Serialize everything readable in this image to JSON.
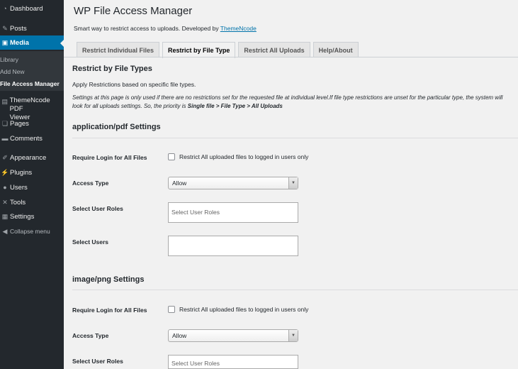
{
  "sidebar": {
    "items": [
      {
        "label": "Dashboard",
        "icon": "dashboard-icon"
      },
      {
        "label": "Posts",
        "icon": "pin-icon"
      },
      {
        "label": "Media",
        "icon": "media-icon"
      },
      {
        "label": "ThemeNcode PDF Viewer",
        "icon": "page-icon"
      },
      {
        "label": "Pages",
        "icon": "pages-icon"
      },
      {
        "label": "Comments",
        "icon": "comments-icon"
      },
      {
        "label": "Appearance",
        "icon": "brush-icon"
      },
      {
        "label": "Plugins",
        "icon": "plugin-icon"
      },
      {
        "label": "Users",
        "icon": "user-icon"
      },
      {
        "label": "Tools",
        "icon": "wrench-icon"
      },
      {
        "label": "Settings",
        "icon": "settings-icon"
      },
      {
        "label": "Collapse menu",
        "icon": "collapse-icon"
      }
    ],
    "media_submenu": [
      "Library",
      "Add New",
      "File Access Manager"
    ],
    "pdf_viewer": {
      "line1": "ThemeNcode PDF",
      "line2": "Viewer"
    },
    "accent": "#0073aa"
  },
  "header": {
    "title": "WP File Access Manager",
    "tagline_prefix": "Smart way to restrict access to uploads. Developed by",
    "tagline_link": "ThemeNcode"
  },
  "tabs": [
    {
      "label": "Restrict Individual Files"
    },
    {
      "label": "Restrict by File Type",
      "active": true
    },
    {
      "label": "Restrict All Uploads"
    },
    {
      "label": "Help/About"
    }
  ],
  "content": {
    "heading": "Restrict by File Types",
    "description": "Apply Restrictions based on specific file types.",
    "note_line1": "Settings at this page is only used if there are no restrictions set for the requested file at individual level.If file type restrictions are unset for the particular type, the system will",
    "note_line2_prefix": "look for all uploads settings. So, the priority is",
    "note_line2_bold": "Single file > File Type > All Uploads"
  },
  "sections": [
    {
      "title": "application/pdf Settings",
      "require_login_label": "Require Login for All Files",
      "checkbox_label": "Restrict All uploaded files to logged in users only",
      "access_type_label": "Access Type",
      "access_type_value": "Allow",
      "roles_label": "Select User Roles",
      "roles_placeholder": "Select User Roles",
      "users_label": "Select Users"
    },
    {
      "title": "image/png Settings",
      "require_login_label": "Require Login for All Files",
      "checkbox_label": "Restrict All uploaded files to logged in users only",
      "access_type_label": "Access Type",
      "access_type_value": "Allow",
      "roles_label": "Select User Roles",
      "roles_placeholder": "Select User Roles"
    }
  ]
}
